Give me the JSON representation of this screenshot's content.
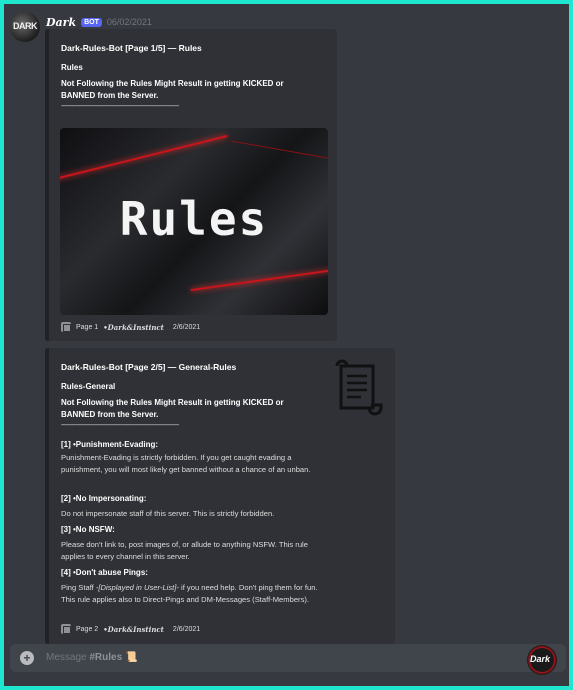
{
  "message": {
    "author": "Dark",
    "bot_tag": "BOT",
    "timestamp": "06/02/2021",
    "avatar_text": "DARK"
  },
  "embed1": {
    "title": "Dark-Rules-Bot [Page 1/5] — Rules",
    "subtitle": "Rules",
    "description": "Not Following the Rules Might Result in getting KICKED or BANNED from the Server.",
    "divider": "--------------------------------------------------------------------",
    "image_text": "Rules",
    "footer": {
      "page": "Page 1",
      "author": "•Dark&Instinct",
      "date": "2/6/2021"
    }
  },
  "embed2": {
    "title": "Dark-Rules-Bot [Page 2/5] — General-Rules",
    "subtitle": "Rules-General",
    "description": "Not Following the Rules Might Result in getting KICKED or BANNED from the Server.",
    "divider": "--------------------------------------------------------------------",
    "rules": [
      {
        "heading": "[1] •Punishment-Evading:",
        "text": "Punishment-Evading is strictly forbidden. If you get caught evading a punishment, you will most likely get banned without a chance of an unban."
      },
      {
        "heading": "[2] •No Impersonating:",
        "text": "Do not impersonate staff of this server. This is strictly forbidden."
      },
      {
        "heading": "[3] •No NSFW:",
        "text": "Please don't link to, post images of, or allude to anything NSFW. This rule applies to every channel in this server."
      },
      {
        "heading": "[4] •Don't abuse Pings:",
        "text_before": "Ping Staff ",
        "text_italic": "-[Displayed in User-List]-",
        "text_after": " if you need help. Don't ping them for fun. This rule applies also to Direct-Pings and DM-Messages (Staff-Members)."
      }
    ],
    "footer": {
      "page": "Page 2",
      "author": "•Dark&Instinct",
      "date": "2/6/2021"
    }
  },
  "input": {
    "placeholder_prefix": "Message ",
    "channel": "#Rules",
    "suffix": "📜"
  },
  "corner_logo_text": "Dark",
  "colors": {
    "frame_border": "#1ee6cf",
    "background": "#36393f",
    "embed_bg": "#2f3136",
    "bot_tag": "#5865f2"
  }
}
